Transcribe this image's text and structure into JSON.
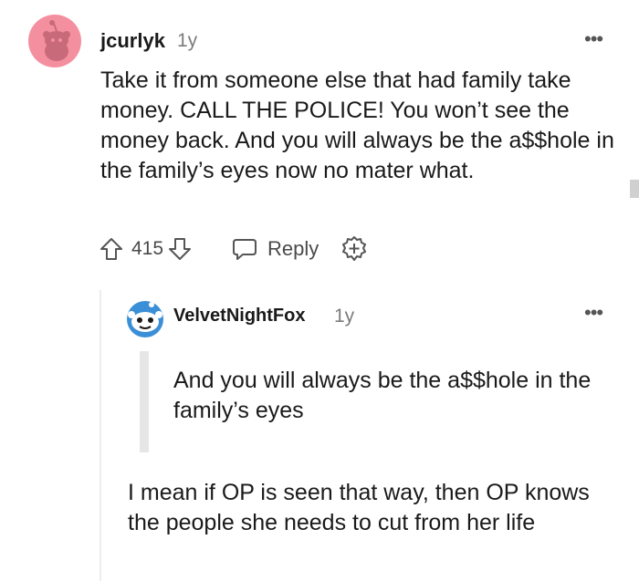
{
  "comment": {
    "username": "jcurlyk",
    "age": "1y",
    "more_icon": "more-horizontal-icon",
    "body": "Take it from someone else that had family take money. CALL THE POLICE! You won’t see the money back. And you will always be the a$$hole in the family’s eyes now no mater what.",
    "score": "415",
    "reply_label": "Reply",
    "avatar_color": "#f48fa0"
  },
  "reply": {
    "username": "VelvetNightFox",
    "age": "1y",
    "quote": "And you will always be the a$$hole in the family’s eyes",
    "body": "I mean if OP is seen that way, then OP knows the people she needs to cut from her life",
    "avatar_color": "#3a8fd6"
  }
}
